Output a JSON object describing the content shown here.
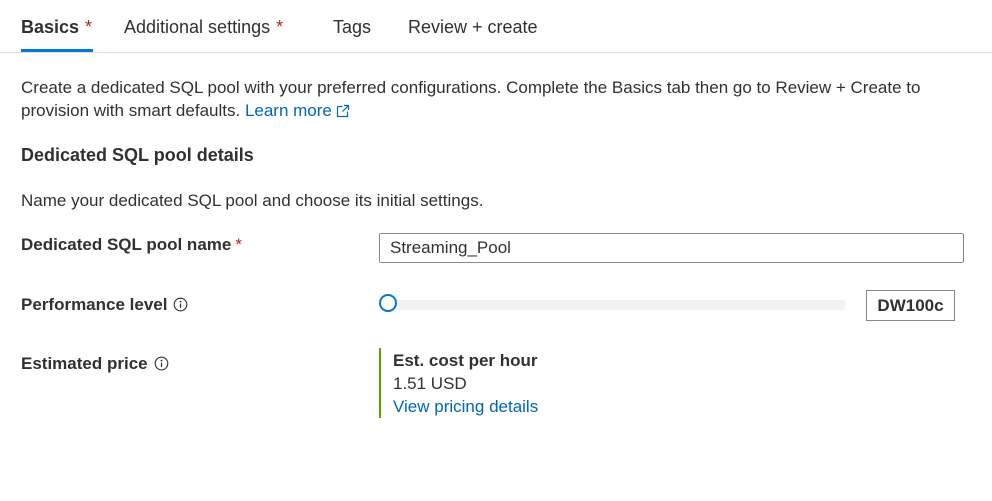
{
  "tabs": [
    {
      "label": "Basics",
      "required": "*"
    },
    {
      "label": "Additional settings",
      "required": "*"
    },
    {
      "label": "Tags",
      "required": ""
    },
    {
      "label": "Review + create",
      "required": ""
    }
  ],
  "intro": {
    "text": "Create a dedicated SQL pool with your preferred configurations. Complete the Basics tab then go to Review + Create to provision with smart defaults.",
    "link": "Learn more"
  },
  "section": {
    "title": "Dedicated SQL pool details",
    "description": "Name your dedicated SQL pool and choose its initial settings."
  },
  "fields": {
    "pool_name": {
      "label": "Dedicated SQL pool name",
      "required": "*",
      "value": "Streaming_Pool"
    },
    "performance": {
      "label": "Performance level",
      "value": "DW100c",
      "slider_fraction": 0
    },
    "price": {
      "label": "Estimated price",
      "title": "Est. cost per hour",
      "value": "1.51 USD",
      "link": "View pricing details"
    }
  },
  "colors": {
    "accent": "#0078d4",
    "link": "#0067b8",
    "required": "#a4262c",
    "price_bar": "#57a300"
  },
  "icons": [
    "external-link-icon",
    "info-icon"
  ]
}
